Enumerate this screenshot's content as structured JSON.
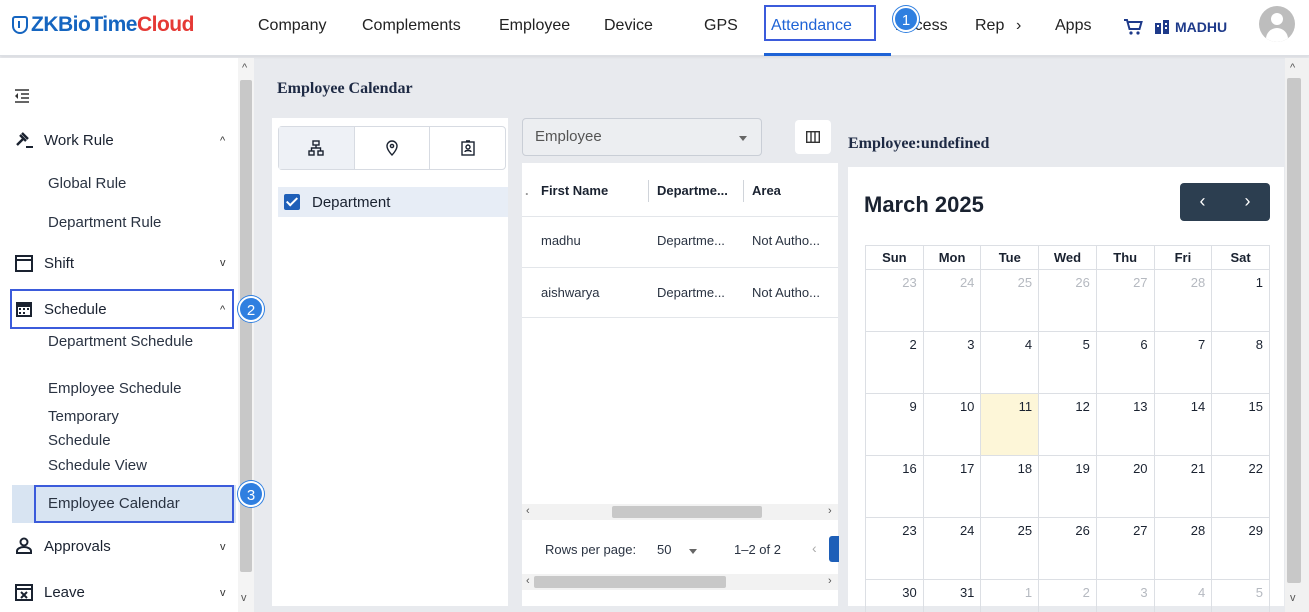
{
  "brand": {
    "zk": "ZKBioTime",
    "cloud": "Cloud"
  },
  "nav": {
    "items": [
      "Company",
      "Complements",
      "Employee",
      "Device",
      "GPS",
      "Attendance",
      "Access",
      "Rep",
      "Apps"
    ],
    "active": "Attendance",
    "more_chevron": "›",
    "user": "MADHU"
  },
  "steps": [
    "1",
    "2",
    "3"
  ],
  "sidebar": {
    "groups": [
      {
        "label": "Work Rule",
        "expanded": true,
        "items": [
          "Global Rule",
          "Department Rule"
        ]
      },
      {
        "label": "Shift",
        "expanded": false,
        "items": []
      },
      {
        "label": "Schedule",
        "expanded": true,
        "items": [
          "Department Schedule",
          "Employee Schedule",
          "Temporary Schedule",
          "Schedule View",
          "Employee Calendar"
        ]
      },
      {
        "label": "Approvals",
        "expanded": false,
        "items": []
      },
      {
        "label": "Leave",
        "expanded": false,
        "items": []
      }
    ],
    "selected": "Employee Calendar"
  },
  "main": {
    "page_title": "Employee Calendar",
    "tree_root": "Department",
    "employee_select": "Employee",
    "table": {
      "columns": [
        "First Name",
        "Departme...",
        "Area"
      ],
      "rows": [
        [
          "madhu",
          "Departme...",
          "Not Autho..."
        ],
        [
          "aishwarya",
          "Departme...",
          "Not Autho..."
        ]
      ],
      "rows_per_page_label": "Rows per page:",
      "rows_per_page": "50",
      "range": "1–2 of 2"
    },
    "employee_label": "Employee:undefined"
  },
  "calendar": {
    "title": "March 2025",
    "prev": "‹",
    "next": "›",
    "weekdays": [
      "Sun",
      "Mon",
      "Tue",
      "Wed",
      "Thu",
      "Fri",
      "Sat"
    ],
    "weeks": [
      [
        "23",
        "24",
        "25",
        "26",
        "27",
        "28",
        "1"
      ],
      [
        "2",
        "3",
        "4",
        "5",
        "6",
        "7",
        "8"
      ],
      [
        "9",
        "10",
        "11",
        "12",
        "13",
        "14",
        "15"
      ],
      [
        "16",
        "17",
        "18",
        "19",
        "20",
        "21",
        "22"
      ],
      [
        "23",
        "24",
        "25",
        "26",
        "27",
        "28",
        "29"
      ],
      [
        "30",
        "31",
        "1",
        "2",
        "3",
        "4",
        "5"
      ]
    ],
    "today": "11"
  },
  "colors": {
    "accent": "#1e63d6",
    "highlight_box": "#3b5bdb",
    "today_bg": "#fdf6d8",
    "nav_dark": "#2c3e50"
  }
}
